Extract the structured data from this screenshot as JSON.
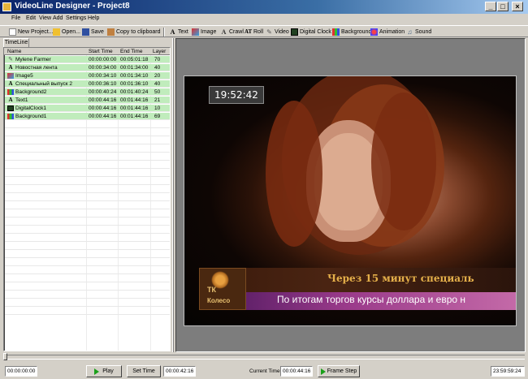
{
  "window": {
    "title": "VideoLine Designer - Project8"
  },
  "menu": [
    "File",
    "Edit",
    "View",
    "Add",
    "Settings",
    "Help"
  ],
  "toolbar": {
    "new_project": "New Project...",
    "open": "Open...",
    "save": "Save",
    "copy": "Copy to clipboard",
    "text": "Text",
    "image": "Image",
    "crawl": "Crawl",
    "roll": "Roll",
    "video": "Video",
    "digital_clock": "Digital Clock",
    "background": "Background",
    "animation": "Animation",
    "sound": "Sound"
  },
  "tab": "TimeLine",
  "columns": [
    "Name",
    "Start Time",
    "End Time",
    "Layer"
  ],
  "rows": [
    {
      "name": "Mylene Farmer",
      "start": "00:00:00:00",
      "end": "00:05:01:18",
      "layer": "70",
      "type": "video-icon"
    },
    {
      "name": "Новостная лента",
      "start": "00:00:34:00",
      "end": "00:01:34:00",
      "layer": "40",
      "type": "text-icon"
    },
    {
      "name": "Image5",
      "start": "00:00:34:10",
      "end": "00:01:34:10",
      "layer": "20",
      "type": "image-icon"
    },
    {
      "name": "Специальный выпуск 2",
      "start": "00:00:36:10",
      "end": "00:01:36:10",
      "layer": "40",
      "type": "text-icon"
    },
    {
      "name": "Background2",
      "start": "00:00:40:24",
      "end": "00:01:40:24",
      "layer": "50",
      "type": "background-icon"
    },
    {
      "name": "Text1",
      "start": "00:00:44:16",
      "end": "00:01:44:16",
      "layer": "21",
      "type": "text-icon"
    },
    {
      "name": "DigitalClock1",
      "start": "00:00:44:16",
      "end": "00:01:44:16",
      "layer": "10",
      "type": "clock-icon"
    },
    {
      "name": "Background1",
      "start": "00:00:44:16",
      "end": "00:01:44:16",
      "layer": "69",
      "type": "background-icon"
    }
  ],
  "preview": {
    "clock": "19:52:42",
    "crawl_text": "Через 15 минут специаль",
    "roll_text": "По итогам торгов курсы доллара и евро н",
    "logo_tk": "ТК",
    "logo_name": "Колесо"
  },
  "status": {
    "left_time": "00:00:00:00",
    "play": "Play",
    "set_time": "Set Time",
    "set_time_value": "00:00:42:16",
    "current_time_label": "Current Time:",
    "current_time": "00:00:44:16",
    "frame_step": "Frame Step",
    "total_time": "23:59:59:24"
  },
  "colors": {
    "row_highlight": "#c0ecbc",
    "title_bar": "#0a246a",
    "crawl_text": "#e5b04a",
    "roll_bar": "#9a3a8a"
  }
}
